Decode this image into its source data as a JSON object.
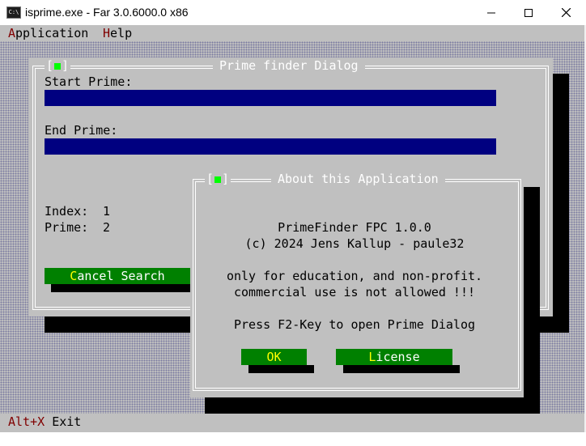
{
  "window": {
    "title": "isprime.exe - Far 3.0.6000.0 x86",
    "icon_text": "C:\\",
    "controls": [
      "minimize-icon",
      "maximize-icon",
      "close-icon"
    ]
  },
  "menu": {
    "items": [
      {
        "hotkey": "A",
        "rest": "pplication"
      },
      {
        "hotkey": "H",
        "rest": "elp"
      }
    ]
  },
  "prime_dialog": {
    "title": "Prime finder Dialog",
    "start_label": "Start Prime:",
    "start_value": "",
    "end_label": "End Prime:",
    "end_value": "",
    "index_label": "Index:",
    "index_value": "1",
    "prime_label": "Prime:",
    "prime_value": "2",
    "cancel_button": {
      "hotkey": "C",
      "rest": "ancel Search"
    }
  },
  "about_dialog": {
    "title": "About this Application",
    "line1": "PrimeFinder FPC 1.0.0",
    "line2": "(c) 2024 Jens Kallup - paule32",
    "line3": "only for education, and non-profit.",
    "line4": "commercial use is not allowed !!!",
    "line5": "Press F2-Key to open Prime Dialog",
    "ok_button": "OK",
    "license_button": {
      "pre": "",
      "hotkey": "L",
      "rest": "icense"
    }
  },
  "status": {
    "key": "Alt+X",
    "label": "Exit"
  },
  "colors": {
    "console_bg": "#c0c0c0",
    "field_bg": "#000080",
    "button_bg": "#008000",
    "hotkey_menu": "#800000",
    "hotkey_button": "#ffff00",
    "closebox": "#00ff00"
  }
}
